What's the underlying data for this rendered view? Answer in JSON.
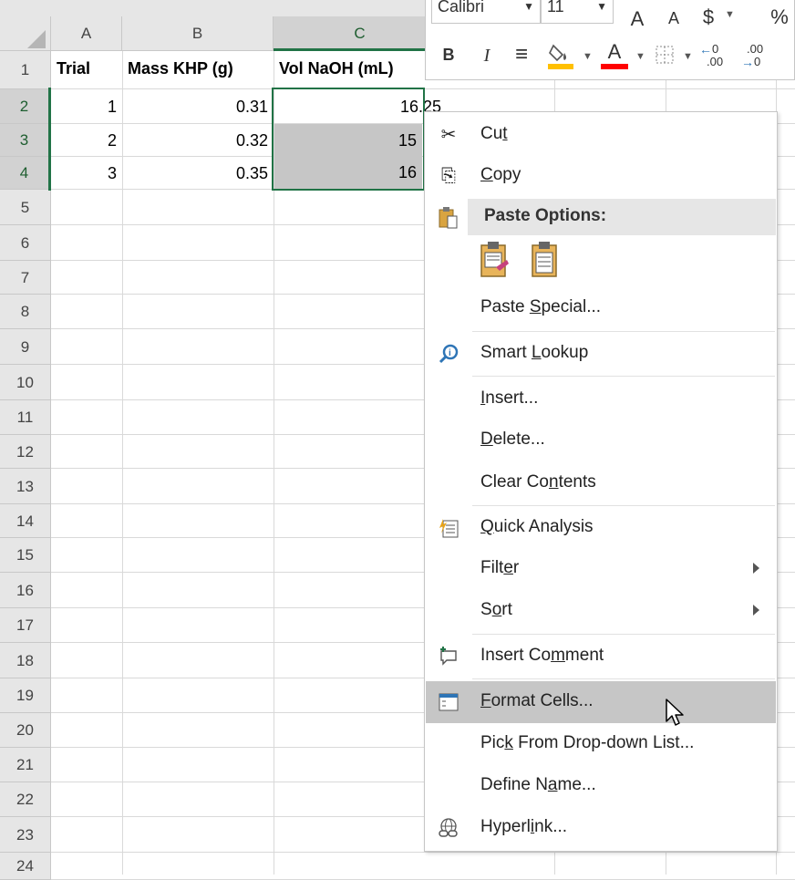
{
  "columns": [
    "A",
    "B",
    "C"
  ],
  "rows": [
    "1",
    "2",
    "3",
    "4",
    "5",
    "6",
    "7",
    "8",
    "9",
    "10",
    "11",
    "12",
    "13",
    "14",
    "15",
    "16",
    "17",
    "18",
    "19",
    "20",
    "21",
    "22",
    "23",
    "24"
  ],
  "header_row": {
    "a": "Trial",
    "b": "Mass KHP (g)",
    "c": "Vol NaOH (mL)"
  },
  "data_rows": [
    {
      "a": "1",
      "b": "0.31",
      "c": "16.25"
    },
    {
      "a": "2",
      "b": "0.32",
      "c": "15"
    },
    {
      "a": "3",
      "b": "0.35",
      "c": "16"
    }
  ],
  "mini_toolbar": {
    "font_name": "Calibri",
    "font_size": "11",
    "increase_font": "A",
    "decrease_font": "A",
    "currency": "$",
    "percent": "%",
    "bold": "B",
    "italic": "I",
    "align": "≡",
    "fill_color": "#ffc000",
    "font_color": "#ff0000",
    "font_color_label": "A",
    "increase_decimal": ".00",
    "decrease_decimal": ".00"
  },
  "context_menu": {
    "cut": {
      "pre": "Cu",
      "u": "t",
      "post": ""
    },
    "copy": {
      "pre": "",
      "u": "C",
      "post": "opy"
    },
    "paste_options": "Paste Options:",
    "paste_special": {
      "pre": "Paste ",
      "u": "S",
      "post": "pecial..."
    },
    "smart_lookup": {
      "pre": "Smart ",
      "u": "L",
      "post": "ookup"
    },
    "insert": {
      "pre": "",
      "u": "I",
      "post": "nsert..."
    },
    "delete": {
      "pre": "",
      "u": "D",
      "post": "elete..."
    },
    "clear_contents": {
      "pre": "Clear Co",
      "u": "n",
      "post": "tents"
    },
    "quick_analysis": {
      "pre": "",
      "u": "Q",
      "post": "uick Analysis"
    },
    "filter": {
      "pre": "Filt",
      "u": "e",
      "post": "r"
    },
    "sort": {
      "pre": "S",
      "u": "o",
      "post": "rt"
    },
    "insert_comment": {
      "pre": "Insert Co",
      "u": "m",
      "post": "ment"
    },
    "format_cells": {
      "pre": "",
      "u": "F",
      "post": "ormat Cells..."
    },
    "pick_from_list": {
      "pre": "Pic",
      "u": "k",
      "post": " From Drop-down List..."
    },
    "define_name": {
      "pre": "Define N",
      "u": "a",
      "post": "me..."
    },
    "hyperlink": {
      "pre": "Hyperl",
      "u": "i",
      "post": "nk..."
    }
  },
  "colors": {
    "selection_green": "#217346",
    "hover_gray": "#c6c6c6"
  }
}
